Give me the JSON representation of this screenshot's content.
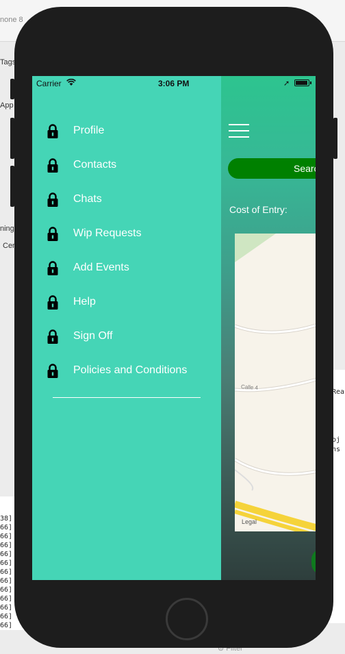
{
  "background": {
    "frag_iphone": "none 8",
    "frag_tags": "Tags",
    "frag_app": "App",
    "frag_ning": "ning",
    "frag_cen": "Cen",
    "frag_filter": "Filter",
    "log_lines": [
      "38]",
      "66]",
      "66]",
      "66]",
      "66]",
      "66]",
      "66]",
      "66]",
      "66]",
      "66]",
      "66]",
      "66]",
      "66]"
    ],
    "right_frag_1": "Rea",
    "right_frag_2": "oj",
    "right_frag_3": "ns"
  },
  "status_bar": {
    "carrier": "Carrier",
    "time": "3:06 PM"
  },
  "drawer": {
    "items": [
      {
        "label": "Profile"
      },
      {
        "label": "Contacts"
      },
      {
        "label": "Chats"
      },
      {
        "label": "Wip Requests"
      },
      {
        "label": "Add Events"
      },
      {
        "label": "Help"
      },
      {
        "label": "Sign Off"
      },
      {
        "label": "Policies and Conditions"
      }
    ]
  },
  "main": {
    "search_label": "Searc",
    "cost_label": "Cost of Entry:",
    "map_street": "Calle 4",
    "map_legal": "Legal"
  },
  "colors": {
    "drawer_bg": "#45d5b6",
    "search_button": "#008000",
    "phone_frame": "#1d1d1d"
  }
}
